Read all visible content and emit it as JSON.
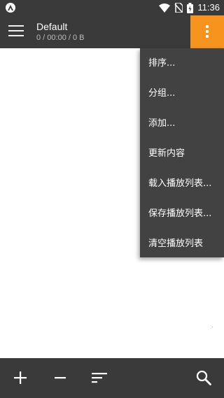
{
  "status_bar": {
    "time": "11:36"
  },
  "toolbar": {
    "title": "Default",
    "subtitle": "0 / 00:00 / 0 B"
  },
  "popup_menu": {
    "items": [
      {
        "label": "排序..."
      },
      {
        "label": "分组..."
      },
      {
        "label": "添加..."
      },
      {
        "label": "更新内容"
      },
      {
        "label": "载入播放列表..."
      },
      {
        "label": "保存播放列表..."
      },
      {
        "label": "清空播放列表"
      }
    ]
  },
  "bottom_bar": {
    "icons": [
      "add-icon",
      "remove-icon",
      "sort-icon",
      "search-icon"
    ]
  },
  "colors": {
    "toolbar": "#3a3a3a",
    "accent": "#f7941e",
    "popup": "#424242"
  }
}
